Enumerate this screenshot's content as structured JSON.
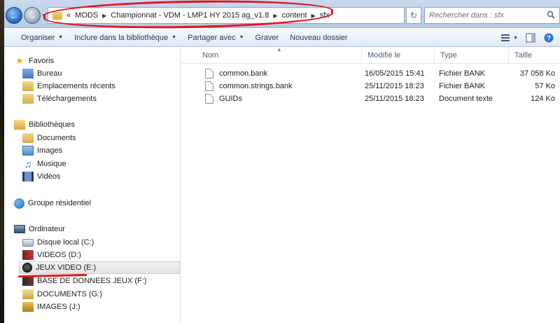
{
  "address": {
    "crumbs": [
      "«",
      "MODS",
      "Championnat - VDM - LMP1 HY 2015 ag_v1.8",
      "content",
      "sfx"
    ]
  },
  "search": {
    "placeholder": "Rechercher dans : sfx"
  },
  "toolbar": {
    "organize": "Organiser",
    "include": "Inclure dans la bibliothèque",
    "share": "Partager avec",
    "burn": "Graver",
    "new_folder": "Nouveau dossier"
  },
  "nav": {
    "favorites": "Favoris",
    "desktop": "Bureau",
    "recent": "Emplacements récents",
    "downloads": "Téléchargements",
    "libraries": "Bibliothèques",
    "documents": "Documents",
    "images": "Images",
    "music": "Musique",
    "videos": "Vidéos",
    "homegroup": "Groupe résidentiel",
    "computer": "Ordinateur",
    "drive_c": "Disque local (C:)",
    "drive_d": "VIDEOS (D:)",
    "drive_e": "JEUX VIDEO (E:)",
    "drive_f": "BASE DE DONNEES JEUX (F:)",
    "drive_g": "DOCUMENTS (G:)",
    "drive_j": "IMAGES (J:)"
  },
  "columns": {
    "name": "Nom",
    "modified": "Modifié le",
    "type": "Type",
    "size": "Taille"
  },
  "files": [
    {
      "name": "common.bank",
      "modified": "16/05/2015 15:41",
      "type": "Fichier BANK",
      "size": "37 058 Ko"
    },
    {
      "name": "common.strings.bank",
      "modified": "25/11/2015 18:23",
      "type": "Fichier BANK",
      "size": "57 Ko"
    },
    {
      "name": "GUIDs",
      "modified": "25/11/2015 18:23",
      "type": "Document texte",
      "size": "124 Ko"
    }
  ],
  "colors": {
    "annotation_red": "#e3141c",
    "toolbar_text": "#1e395b",
    "header_text": "#4c607a"
  }
}
